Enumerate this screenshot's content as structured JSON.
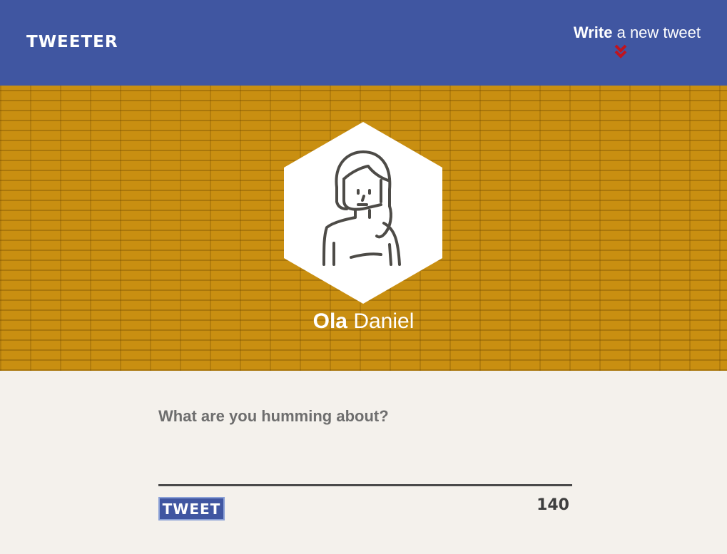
{
  "nav": {
    "logo": "TWEETER",
    "compose": {
      "strong": "Write",
      "rest": "a new tweet",
      "icon": "double-chevron-down-icon",
      "icon_color": "#c0141e"
    },
    "background": "#4056a1"
  },
  "profile": {
    "first_name": "Ola",
    "last_name": "Daniel",
    "avatar_icon": "woman-avatar-icon",
    "header_color": "#c98f11"
  },
  "composer": {
    "placeholder": "What are you humming about?",
    "value": "",
    "button_label": "TWEET",
    "counter": "140"
  }
}
